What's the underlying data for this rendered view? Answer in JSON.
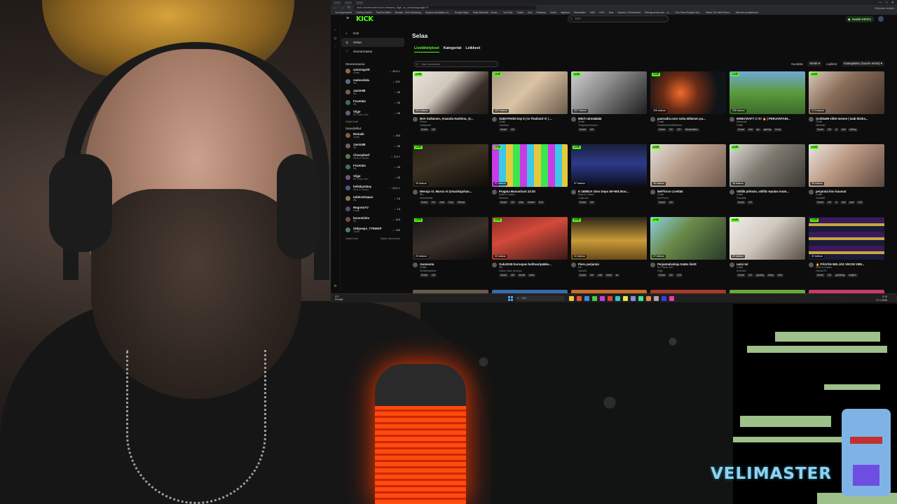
{
  "overlay": {
    "watermark": "VELIMASTER"
  },
  "browser": {
    "url": "kick.com/browse?sort=viewers_high_to_low&language=fi",
    "bookmarks": [
      "Tuo kirjanmerkit",
      "Getting Started",
      "PayPal Wallet",
      "Browse · Kick Streaming",
      "Support velimaster on...",
      "Google Maps",
      "Elisa Webmail – Tervet...",
      "YouTube",
      "Twitch",
      "Kick",
      "Reinterpr",
      "Botrix",
      "Nightbot",
      "Streamlabs",
      "OBS",
      "GOG",
      "Epic",
      "Games | GGDetected",
      "Retrogrounds.com – Li...",
      "One Piece English Sub...",
      "Watch The Wild Robot...",
      "Aikuinen sivutallenne..."
    ],
    "window_controls": [
      "—",
      "□",
      "✕"
    ],
    "right_info": "Kirjaudu sisään"
  },
  "kick": {
    "logo": "KICK",
    "search_placeholder": "Etsi",
    "get_kicks": "Hanki KICKs",
    "nav": [
      {
        "label": "Koti",
        "icon": "home-icon"
      },
      {
        "label": "Selaa",
        "icon": "compass-icon"
      },
      {
        "label": "Seurannassa",
        "icon": "heart-icon"
      }
    ],
    "following_title": "Seurannassa",
    "following": [
      {
        "name": "asmongold",
        "sub": "Chatti",
        "count": "10,5 t.",
        "color": "#8a6b4a"
      },
      {
        "name": "maleonkda",
        "sub": "IRL",
        "count": "101",
        "color": "#5a6b8a"
      },
      {
        "name": "Jamis88",
        "sub": "IRL",
        "count": "46",
        "color": "#7a5a5a"
      },
      {
        "name": "Fsantala",
        "sub": "IRL",
        "count": "45",
        "color": "#4a6a5a"
      },
      {
        "name": "Viige",
        "sub": "RV There Yet?",
        "count": "26",
        "color": "#6a5a7a"
      }
    ],
    "show_more": "Näytä lisää",
    "recommended_title": "Suositellut",
    "recommended": [
      {
        "name": "Reinaki",
        "sub": "Chatti",
        "count": "163",
        "color": "#8a5a4a"
      },
      {
        "name": "Jamis88",
        "sub": "IRL",
        "count": "46",
        "color": "#7a5a5a"
      },
      {
        "name": "Classybeef",
        "sub": "Slots & Casino",
        "count": "2,4 t.",
        "color": "#5a7a4a"
      },
      {
        "name": "Fsantala",
        "sub": "IRL",
        "count": "45",
        "color": "#4a6a5a"
      },
      {
        "name": "Viige",
        "sub": "RV There Yet?",
        "count": "26",
        "color": "#6a5a7a"
      },
      {
        "name": "hellskytskey",
        "sub": "Slots & Casino",
        "count": "12,0 t.",
        "color": "#4a5a8a"
      },
      {
        "name": "taideoskopaa",
        "sub": "IRL",
        "count": "15",
        "color": "#8a7a4a"
      },
      {
        "name": "RegretsTV",
        "sub": "Chatti",
        "count": "13",
        "color": "#5a4a6a"
      },
      {
        "name": "bonestinks",
        "sub": "IRL",
        "count": "423",
        "color": "#7a4a4a"
      },
      {
        "name": "Oldpeeps_TTRMSP",
        "sub": "Chatti",
        "count": "139",
        "color": "#4a7a7a"
      }
    ],
    "show_more_2": "Näytä lisää",
    "show_less": "Näytä vähemmän",
    "page_title": "Selaa",
    "tabs": [
      "Livelähetykset",
      "Kategoriat",
      "Leikkeet"
    ],
    "tag_search_placeholder": "Hae tunnisteita",
    "filter_label": "Suodata:",
    "filter_value": "Kielet",
    "sort_label": "Lajittele:",
    "sort_value": "Katsojaluku (Suurin ensin)",
    "live_badge": "LIVE",
    "streams": [
      {
        "viewers": "531 katsoa",
        "title": "Bert Sulkanen, Amanda Harkimo, @...",
        "user": "Preloe",
        "cat": "nettipokeri",
        "tags": [
          "Suomi",
          "18+"
        ],
        "bg": "linear-gradient(135deg,#e9e4dc 0%,#cfc6ba 40%,#3b2f2a 70%,#1e1a18 100%)"
      },
      {
        "viewers": "422 katsoa",
        "title": "SUBATHON Day 5 | In Thailand !!! | ...",
        "user": "Chatti",
        "cat": "Jutunikai",
        "tags": [
          "Suomi",
          "18+"
        ],
        "bg": "linear-gradient(135deg,#a89a86 0%,#d9c3a4 45%,#6b5a4a 100%)"
      },
      {
        "viewers": "307 katsoa",
        "title": "MIKÄ tärmäääää",
        "user": "Chatti",
        "cat": "Tirsppstummsprru",
        "tags": [
          "Suomi",
          "18+"
        ],
        "bg": "linear-gradient(135deg,#cfcfcf 0%,#8d8d8d 40%,#1d1d1d 100%)"
      },
      {
        "viewers": "206 katsoa",
        "title": "pasiradio.com soita tällaisen pu...",
        "user": "Chatti",
        "cat": "PasiWhereIsItWatchen",
        "tags": [
          "Suomi",
          "18+",
          "19+",
          "Musicstation"
        ],
        "bg": "radial-gradient(circle at 40% 50%,#f06a2a 0%,#6a2c16 35%,#101318 75%)"
      },
      {
        "viewers": "206 katsoa",
        "title": "MINECRAFT 2 !!!! 🔥 | PERJANTAIN...",
        "user": "Minecraft",
        "cat": "Fullifit",
        "tags": [
          "Suomi",
          "chill",
          "fps",
          "gaming",
          "funny"
        ],
        "bg": "linear-gradient(180deg,#6ea8d8 0%,#5b9a3c 50%,#3b6a2a 100%)"
      },
      {
        "viewers": "174 katsoa",
        "title": "@uhka69 vitkö menee | taab tkicks...",
        "user": "Chatti",
        "cat": "Ilkkimäki",
        "tags": [
          "Suomi",
          "18+",
          "irl",
          "chill",
          "talking"
        ],
        "bg": "linear-gradient(135deg,#d8c8b8 0%,#8b6f5a 40%,#3b2e26 100%)"
      },
      {
        "viewers": "40 katsoa",
        "title": "Menoja VL Marsu ei @marikajohan...",
        "user": "IRL",
        "cat": "recloseinkia",
        "tags": [
          "Suomi",
          "18+",
          "chat",
          "Cozy",
          "Fitness"
        ],
        "bg": "linear-gradient(160deg,#2a2418 0%,#3d3224 40%,#0f0d0a 100%)"
      },
      {
        "viewers": "97 katsoa",
        "title": "Pragma Bonushunt 23:30",
        "user": "Slots & Casino",
        "cat": "Mrkesva",
        "tags": [
          "Suomi",
          "18+",
          "slots",
          "fortune",
          "K18"
        ],
        "bg": "repeating-linear-gradient(90deg,#c83ce6 0 10px,#3cc8e6 10px 20px,#e6c83c 20px 30px,#3ce64f 30px 40px)"
      },
      {
        "viewers": "57 katsoa",
        "title": "K-18/MGA Omo Depo 50+50€ Bon...",
        "user": "Slots & Casino",
        "cat": "LuilyLuku",
        "tags": [
          "Suomi",
          "18+"
        ],
        "bg": "linear-gradient(180deg,#1a1f3a 0%,#2d3b8a 45%,#0b0d1a 100%)"
      },
      {
        "viewers": "46 katsoa",
        "title": "Mel*force Liveltää",
        "user": "Chatti",
        "cat": "Mel*Force",
        "tags": [
          "Suomi",
          "18+"
        ],
        "bg": "linear-gradient(135deg,#e4e0da 0%,#b59a88 45%,#6e5a4e 100%)"
      },
      {
        "viewers": "48 katsoa",
        "title": "Välillä pöhnäs, välillä repulas mute...",
        "user": "Chatti",
        "cat": "Fsantala",
        "tags": [
          "Suomi",
          "18+"
        ],
        "bg": "linear-gradient(135deg,#e0dcd6 0%,#7e7a70 45%,#3c3a36 100%)"
      },
      {
        "viewers": "48 katsoa",
        "title": "perjantai ilon huumat",
        "user": "Chatti",
        "cat": "Jamis88",
        "tags": [
          "Suomi",
          "18+",
          "irl",
          "chill",
          "paul",
          "K18"
        ],
        "bg": "linear-gradient(135deg,#e9e6e0 0%,#b99580 45%,#5b4a40 100%)"
      },
      {
        "viewers": "24 katsoa",
        "title": "Juomenta",
        "user": "Chatti",
        "cat": "Dundertopinka",
        "tags": [
          "Suomi",
          "18+"
        ],
        "bg": "linear-gradient(160deg,#1a1716 0%,#3a302a 50%,#0c0a09 100%)"
      },
      {
        "viewers": "32 katsoa",
        "title": "Oulu2026 Euroopan kulttuuripääke...",
        "user": "IRL",
        "cat": "Oulun_Asia_Ilvesvys",
        "tags": [
          "Suomi",
          "18+",
          "druink",
          "autor"
        ],
        "bg": "linear-gradient(160deg,#8a2a2a 0%,#d24a3a 40%,#3a1a18 100%)"
      },
      {
        "viewers": "31 katsoa",
        "title": "Pieru perjantai",
        "user": "IRL",
        "cat": "Jaotu02",
        "tags": [
          "Suomi",
          "18+",
          "chill",
          "travel",
          "au"
        ],
        "bg": "linear-gradient(180deg,#2a2416 0%,#c89a3a 55%,#6a4a18 100%)"
      },
      {
        "viewers": "27 katsoa",
        "title": "Perjantai/veloja tnään ilmitt",
        "user": "RV There Yet?",
        "cat": "Viige",
        "tags": [
          "Suomi",
          "18+",
          "K18"
        ],
        "bg": "linear-gradient(135deg,#8ad0e0 0%,#6a8a4a 40%,#2a3a2a 100%)"
      },
      {
        "viewers": "25 katsoa",
        "title": "natsi tul",
        "user": "Chatti",
        "cat": "KickJami",
        "tags": [
          "Suomi",
          "18+",
          "gaming",
          "funny",
          "chat"
        ],
        "bg": "linear-gradient(135deg,#f0ede8 0%,#cfc8be 45%,#5a4e46 100%)"
      },
      {
        "viewers": "22 katsoa",
        "title": "🔥 PÄIVÄN NELJÄS VIKON VIIM...",
        "user": "Slots & Casino",
        "cat": "HarassTV",
        "tags": [
          "Suomi",
          "18+",
          "gambling",
          "english"
        ],
        "bg": "repeating-linear-gradient(0deg,#1a1a3a 0 8px,#c8a83c 8px 12px,#3a1a5a 12px 20px)"
      }
    ],
    "partial_row": [
      "#6a5a4a",
      "#3a6aa8",
      "#c86a2a",
      "#a83a2a",
      "#6aa83a",
      "#c83a6a"
    ]
  },
  "taskbar": {
    "weather_temp": "3°C",
    "weather_desc": "Pilvistä",
    "search_placeholder": "Hae",
    "time": "0.10",
    "date": "17.1.2026",
    "apps": [
      "#f0c040",
      "#e8542a",
      "#3a8ae8",
      "#4ac84a",
      "#c83ae8",
      "#e83a3a",
      "#2ac8c8",
      "#e8e83a",
      "#8a8ae8",
      "#3ae88a",
      "#e88a3a",
      "#aaaaaa",
      "#3a3ae8",
      "#e83aaa"
    ]
  }
}
